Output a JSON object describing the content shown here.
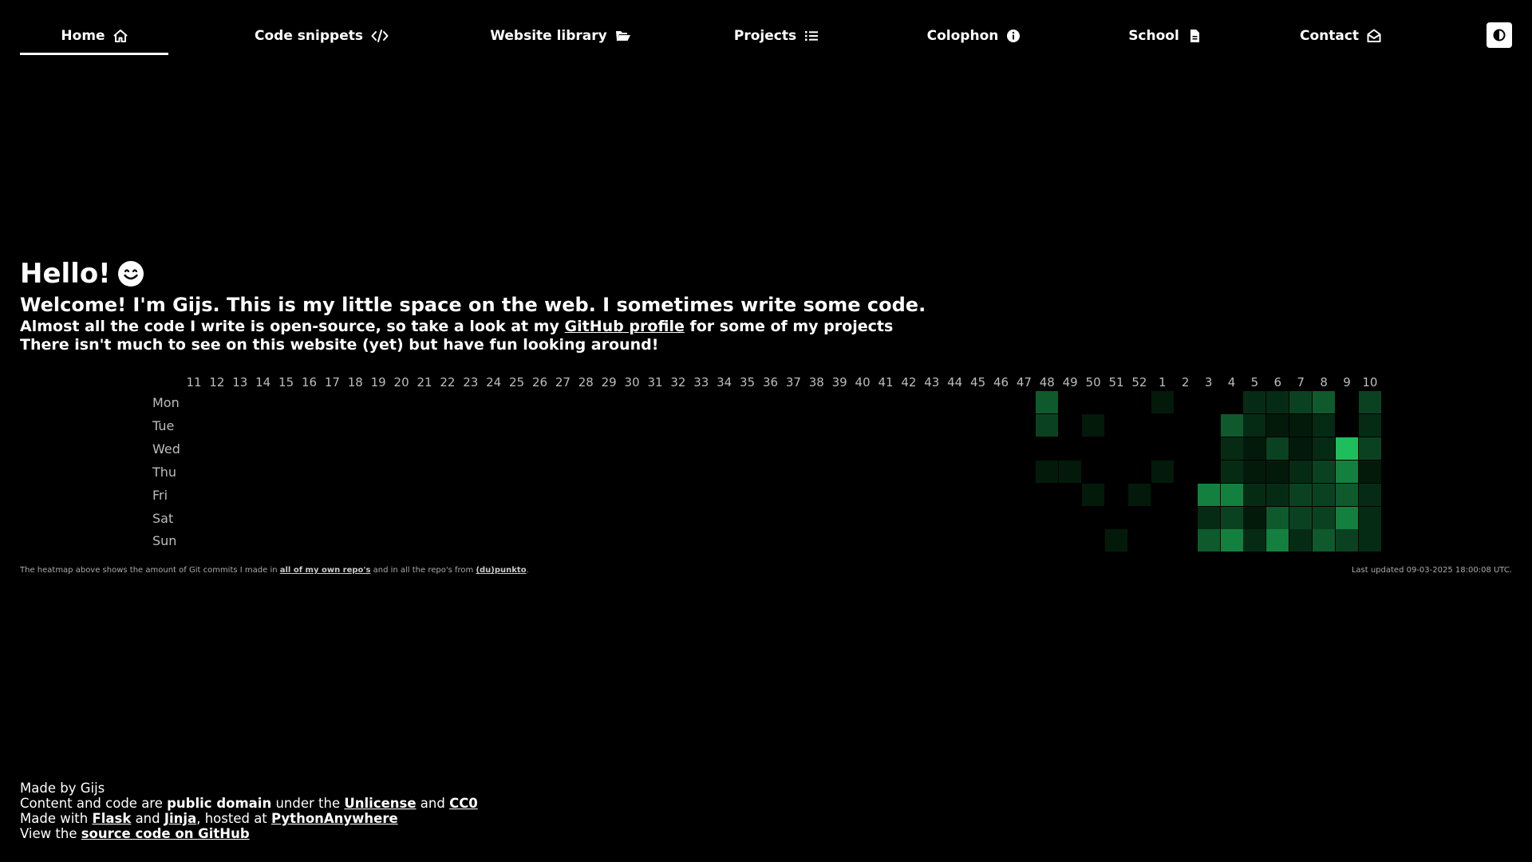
{
  "nav": {
    "items": [
      {
        "label": "Home",
        "icon": "home-icon",
        "active": true
      },
      {
        "label": "Code snippets",
        "icon": "code-icon"
      },
      {
        "label": "Website library",
        "icon": "folder-open-icon"
      },
      {
        "label": "Projects",
        "icon": "list-icon"
      },
      {
        "label": "Colophon",
        "icon": "info-icon"
      },
      {
        "label": "School",
        "icon": "file-icon"
      },
      {
        "label": "Contact",
        "icon": "envelope-open-icon"
      }
    ],
    "theme_toggle_icon": "contrast-icon"
  },
  "intro": {
    "hello": "Hello!",
    "emoji": "😊",
    "welcome": "Welcome! I'm Gijs. This is my little space on the web. I sometimes write some code.",
    "line1_before": "Almost all the code I write is open-source, so take a look at my ",
    "line1_link": "GitHub profile",
    "line1_after": " for some of my projects",
    "line2": "There isn't much to see on this website (yet) but have fun looking around!"
  },
  "heatmap": {
    "weeks": [
      "11",
      "12",
      "13",
      "14",
      "15",
      "16",
      "17",
      "18",
      "19",
      "20",
      "21",
      "22",
      "23",
      "24",
      "25",
      "26",
      "27",
      "28",
      "29",
      "30",
      "31",
      "32",
      "33",
      "34",
      "35",
      "36",
      "37",
      "38",
      "39",
      "40",
      "41",
      "42",
      "43",
      "44",
      "45",
      "46",
      "47",
      "48",
      "49",
      "50",
      "51",
      "52",
      "1",
      "2",
      "3",
      "4",
      "5",
      "6",
      "7",
      "8",
      "9",
      "10"
    ],
    "days": [
      "Mon",
      "Tue",
      "Wed",
      "Thu",
      "Fri",
      "Sat",
      "Sun"
    ],
    "colors": [
      "#000000",
      "#031a0b",
      "#062b14",
      "#0a4221",
      "#0e5a2d",
      "#13803f",
      "#1fbe5c"
    ],
    "levels": [
      [
        0,
        0,
        0,
        0,
        0,
        0,
        0,
        0,
        0,
        0,
        0,
        0,
        0,
        0,
        0,
        0,
        0,
        0,
        0,
        0,
        0,
        0,
        0,
        0,
        0,
        0,
        0,
        0,
        0,
        0,
        0,
        0,
        0,
        0,
        0,
        0,
        0,
        4,
        0,
        0,
        0,
        0,
        1,
        0,
        0,
        0,
        2,
        2,
        3,
        4,
        0,
        3
      ],
      [
        0,
        0,
        0,
        0,
        0,
        0,
        0,
        0,
        0,
        0,
        0,
        0,
        0,
        0,
        0,
        0,
        0,
        0,
        0,
        0,
        0,
        0,
        0,
        0,
        0,
        0,
        0,
        0,
        0,
        0,
        0,
        0,
        0,
        0,
        0,
        0,
        0,
        3,
        0,
        1,
        0,
        0,
        0,
        0,
        0,
        4,
        2,
        1,
        1,
        2,
        0,
        2
      ],
      [
        0,
        0,
        0,
        0,
        0,
        0,
        0,
        0,
        0,
        0,
        0,
        0,
        0,
        0,
        0,
        0,
        0,
        0,
        0,
        0,
        0,
        0,
        0,
        0,
        0,
        0,
        0,
        0,
        0,
        0,
        0,
        0,
        0,
        0,
        0,
        0,
        0,
        0,
        0,
        0,
        0,
        0,
        0,
        0,
        0,
        2,
        1,
        3,
        1,
        2,
        6,
        3
      ],
      [
        0,
        0,
        0,
        0,
        0,
        0,
        0,
        0,
        0,
        0,
        0,
        0,
        0,
        0,
        0,
        0,
        0,
        0,
        0,
        0,
        0,
        0,
        0,
        0,
        0,
        0,
        0,
        0,
        0,
        0,
        0,
        0,
        0,
        0,
        0,
        0,
        0,
        1,
        1,
        0,
        0,
        0,
        1,
        0,
        0,
        2,
        1,
        1,
        2,
        3,
        5,
        1
      ],
      [
        0,
        0,
        0,
        0,
        0,
        0,
        0,
        0,
        0,
        0,
        0,
        0,
        0,
        0,
        0,
        0,
        0,
        0,
        0,
        0,
        0,
        0,
        0,
        0,
        0,
        0,
        0,
        0,
        0,
        0,
        0,
        0,
        0,
        0,
        0,
        0,
        0,
        0,
        0,
        1,
        0,
        1,
        0,
        0,
        5,
        5,
        2,
        2,
        3,
        3,
        4,
        2
      ],
      [
        0,
        0,
        0,
        0,
        0,
        0,
        0,
        0,
        0,
        0,
        0,
        0,
        0,
        0,
        0,
        0,
        0,
        0,
        0,
        0,
        0,
        0,
        0,
        0,
        0,
        0,
        0,
        0,
        0,
        0,
        0,
        0,
        0,
        0,
        0,
        0,
        0,
        0,
        0,
        0,
        0,
        0,
        0,
        0,
        2,
        3,
        1,
        4,
        3,
        3,
        5,
        2
      ],
      [
        0,
        0,
        0,
        0,
        0,
        0,
        0,
        0,
        0,
        0,
        0,
        0,
        0,
        0,
        0,
        0,
        0,
        0,
        0,
        0,
        0,
        0,
        0,
        0,
        0,
        0,
        0,
        0,
        0,
        0,
        0,
        0,
        0,
        0,
        0,
        0,
        0,
        0,
        0,
        0,
        1,
        0,
        0,
        0,
        4,
        5,
        2,
        5,
        2,
        4,
        3,
        2
      ]
    ],
    "caption_before": "The heatmap above shows the amount of Git commits I made in ",
    "caption_link1": "all of my own repo's",
    "caption_mid": " and in all the repo's from ",
    "caption_link2": "(du)punkto",
    "caption_after": ".",
    "updated": "Last updated 09-03-2025 18:00:08 UTC."
  },
  "footer": {
    "made_by": "Made by Gijs",
    "l2_a": "Content and code are ",
    "l2_b": "public domain",
    "l2_c": " under the ",
    "l2_d": "Unlicense",
    "l2_e": " and ",
    "l2_f": "CC0",
    "l3_a": "Made with ",
    "l3_b": "Flask",
    "l3_c": " and ",
    "l3_d": "Jinja",
    "l3_e": ", hosted at ",
    "l3_f": "PythonAnywhere",
    "l4_a": "View the ",
    "l4_b": "source code on GitHub"
  }
}
